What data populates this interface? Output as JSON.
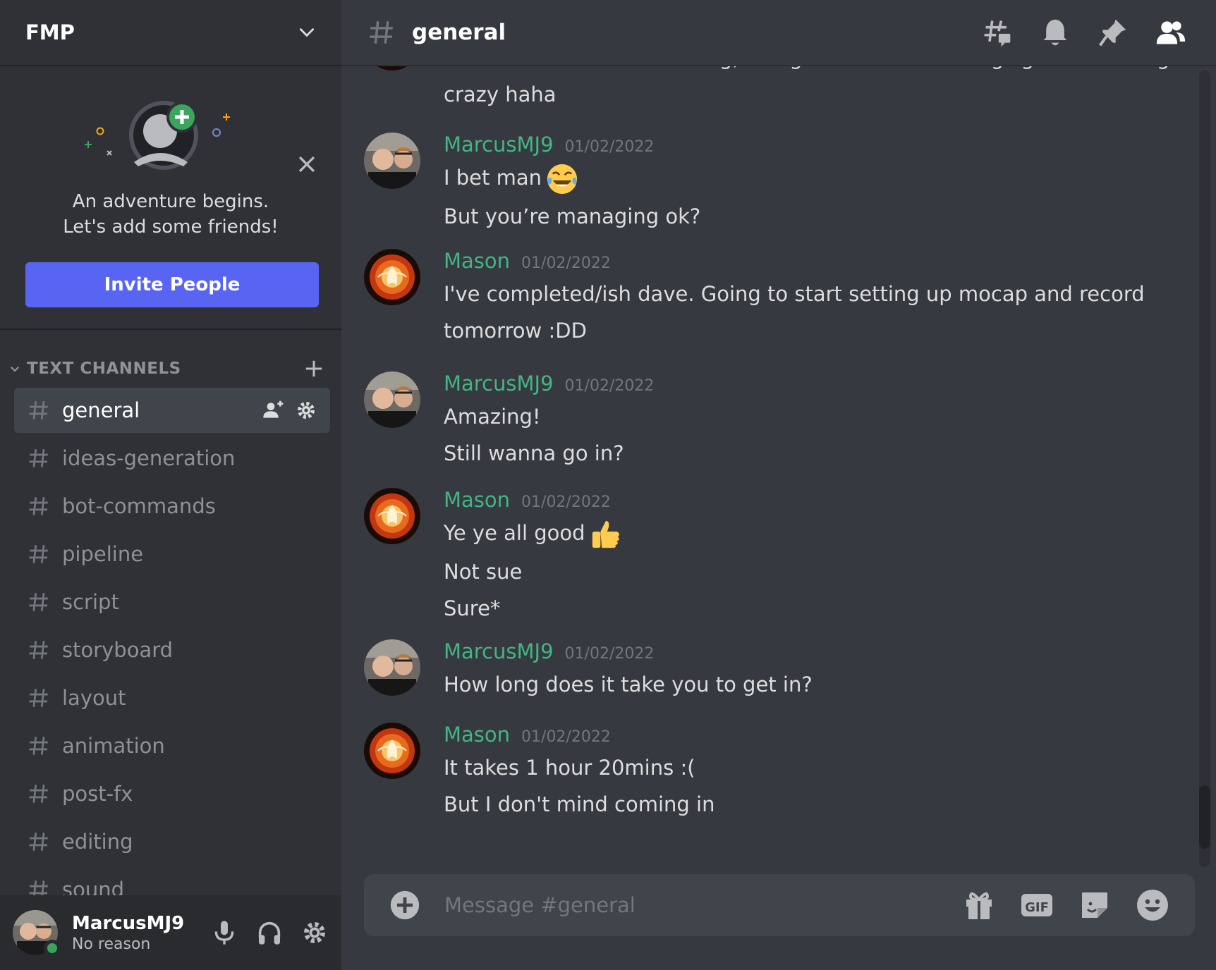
{
  "server": {
    "name": "FMP"
  },
  "welcome": {
    "line1": "An adventure begins.",
    "line2": "Let's add some friends!",
    "invite_label": "Invite People"
  },
  "category": {
    "label": "TEXT CHANNELS"
  },
  "channels": [
    {
      "name": "general",
      "active": true
    },
    {
      "name": "ideas-generation"
    },
    {
      "name": "bot-commands"
    },
    {
      "name": "pipeline"
    },
    {
      "name": "script"
    },
    {
      "name": "storyboard"
    },
    {
      "name": "layout"
    },
    {
      "name": "animation"
    },
    {
      "name": "post-fx"
    },
    {
      "name": "editing"
    },
    {
      "name": "sound"
    }
  ],
  "user": {
    "name": "MarcusMJ9",
    "status": "No reason",
    "presence_color": "#3ba55d"
  },
  "topbar": {
    "channel": "general"
  },
  "messages": {
    "partial_top": [
      "Yeah man I feel on texturing, doing these character rigs got me feeling",
      "crazy haha"
    ],
    "groups": [
      {
        "author": "MarcusMJ9",
        "time": "01/02/2022",
        "lines": [
          "I bet man",
          "But you’re managing ok?"
        ],
        "emoji": "joy"
      },
      {
        "author": "Mason",
        "time": "01/02/2022",
        "lines": [
          "I've completed/ish dave. Going to start setting up mocap and record",
          "tomorrow :DD"
        ]
      },
      {
        "author": "MarcusMJ9",
        "time": "01/02/2022",
        "lines": [
          "Amazing!",
          "Still wanna go in?"
        ]
      },
      {
        "author": "Mason",
        "time": "01/02/2022",
        "lines": [
          "Ye ye all good",
          "Not sue",
          "Sure*"
        ],
        "emoji": "thumbs-up"
      },
      {
        "author": "MarcusMJ9",
        "time": "01/02/2022",
        "lines": [
          "How long does it take you to get in?"
        ]
      },
      {
        "author": "Mason",
        "time": "01/02/2022",
        "lines": [
          "It takes 1 hour 20mins :(",
          "But I don't mind coming in"
        ]
      }
    ]
  },
  "composer": {
    "placeholder": "Message #general",
    "gif_label": "GIF"
  },
  "colors": {
    "accent": "#5865f2",
    "author": "#43b581",
    "bg": "#36393f",
    "sidebar": "#2f3136"
  }
}
